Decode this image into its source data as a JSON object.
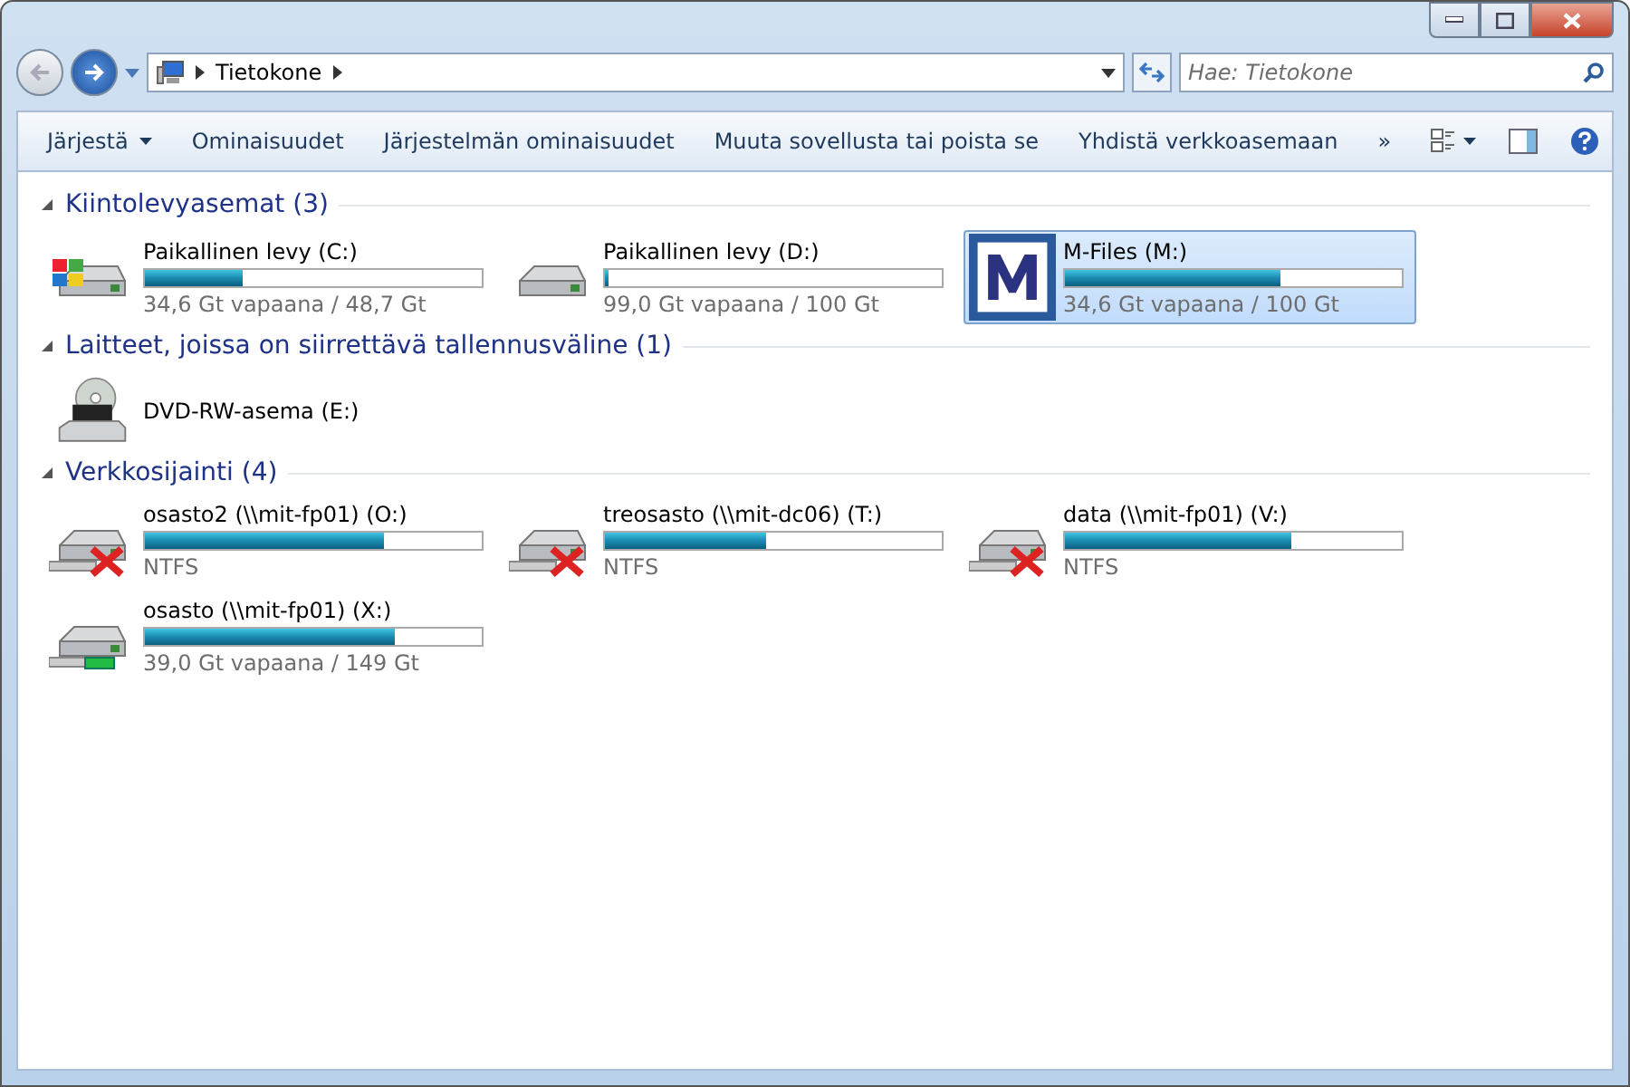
{
  "address_bar": {
    "path": "Tietokone"
  },
  "search": {
    "placeholder": "Hae: Tietokone"
  },
  "toolbar": {
    "items": [
      {
        "label": "Järjestä",
        "kind": "menu"
      },
      {
        "label": "Ominaisuudet",
        "kind": "button"
      },
      {
        "label": "Järjestelmän ominaisuudet",
        "kind": "button"
      },
      {
        "label": "Muuta sovellusta tai poista se",
        "kind": "button"
      },
      {
        "label": "Yhdistä verkkoasemaan",
        "kind": "button"
      },
      {
        "label": "»",
        "kind": "button"
      }
    ]
  },
  "groups": [
    {
      "title": "Kiintolevyasemat (3)",
      "expanded": true,
      "items": [
        {
          "name": "Paikallinen levy (C:)",
          "kind": "windows",
          "level": 0.29,
          "detail": "34,6 Gt vapaana / 48,7 Gt",
          "selected": false
        },
        {
          "name": "Paikallinen levy (D:)",
          "kind": "hdd",
          "level": 0.01,
          "detail": "99,0 Gt vapaana / 100 Gt",
          "selected": false
        },
        {
          "name": "M-Files (M:)",
          "kind": "mfiles",
          "level": 0.64,
          "detail": "34,6 Gt vapaana / 100 Gt",
          "selected": true
        }
      ]
    },
    {
      "title": "Laitteet, joissa on siirrettävä tallennusväline (1)",
      "expanded": true,
      "items": [
        {
          "name": "DVD-RW-asema (E:)",
          "kind": "dvd",
          "selected": false
        }
      ]
    },
    {
      "title": "Verkkosijainti (4)",
      "expanded": true,
      "items": [
        {
          "name": "osasto2 (\\\\mit-fp01) (O:)",
          "kind": "network_disconnected",
          "level": 0.71,
          "detail": "NTFS",
          "selected": false
        },
        {
          "name": "treosasto (\\\\mit-dc06) (T:)",
          "kind": "network_disconnected",
          "level": 0.48,
          "detail": "NTFS",
          "selected": false
        },
        {
          "name": "data (\\\\mit-fp01) (V:)",
          "kind": "network_disconnected",
          "level": 0.67,
          "detail": "NTFS",
          "selected": false
        },
        {
          "name": "osasto (\\\\mit-fp01) (X:)",
          "kind": "network_connected",
          "level": 0.74,
          "detail": "39,0 Gt vapaana / 149 Gt",
          "selected": false
        }
      ]
    }
  ]
}
